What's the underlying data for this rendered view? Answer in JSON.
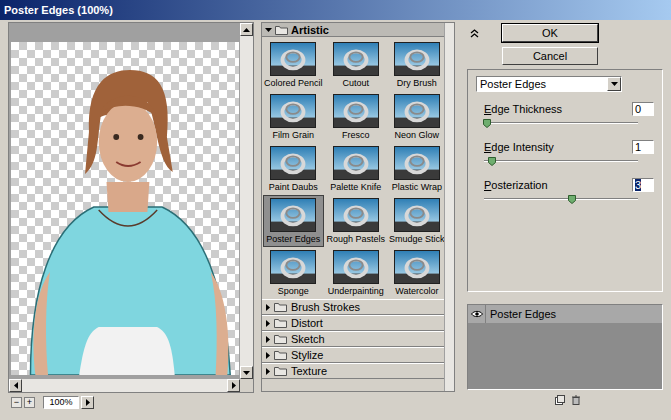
{
  "window": {
    "title": "Poster Edges (100%)"
  },
  "preview": {
    "zoom_out": "−",
    "zoom_in": "+",
    "zoom": "100%"
  },
  "gallery": {
    "open_category": {
      "label": "Artistic",
      "expanded": true
    },
    "filters": [
      {
        "label": "Colored Pencil",
        "selected": false
      },
      {
        "label": "Cutout",
        "selected": false
      },
      {
        "label": "Dry Brush",
        "selected": false
      },
      {
        "label": "Film Grain",
        "selected": false
      },
      {
        "label": "Fresco",
        "selected": false
      },
      {
        "label": "Neon Glow",
        "selected": false
      },
      {
        "label": "Paint Daubs",
        "selected": false
      },
      {
        "label": "Palette Knife",
        "selected": false
      },
      {
        "label": "Plastic Wrap",
        "selected": false
      },
      {
        "label": "Poster Edges",
        "selected": true
      },
      {
        "label": "Rough Pastels",
        "selected": false
      },
      {
        "label": "Smudge Stick",
        "selected": false
      },
      {
        "label": "Sponge",
        "selected": false
      },
      {
        "label": "Underpainting",
        "selected": false
      },
      {
        "label": "Watercolor",
        "selected": false
      }
    ],
    "categories": [
      {
        "label": "Brush Strokes",
        "expanded": false
      },
      {
        "label": "Distort",
        "expanded": false
      },
      {
        "label": "Sketch",
        "expanded": false
      },
      {
        "label": "Stylize",
        "expanded": false
      },
      {
        "label": "Texture",
        "expanded": false
      }
    ]
  },
  "buttons": [
    "OK",
    "Cancel"
  ],
  "filter_select": {
    "value": "Poster Edges"
  },
  "settings": [
    {
      "label": "Edge Thickness",
      "value": "0",
      "level": 0,
      "focused": false
    },
    {
      "label": "Edge Intensity",
      "value": "1",
      "level": 0.03,
      "focused": false
    },
    {
      "label": "Posterization",
      "value": "3",
      "level": 0.55,
      "focused": true
    }
  ],
  "effect_layers": [
    {
      "label": "Poster Edges",
      "visible": true,
      "selected": true
    }
  ]
}
